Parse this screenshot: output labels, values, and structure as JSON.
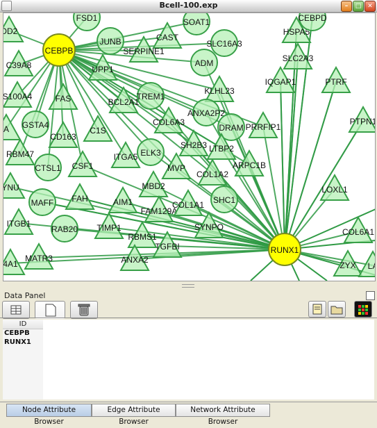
{
  "window": {
    "title": "Bcell-100.exp"
  },
  "network": {
    "hubs": [
      "CEBPB",
      "RUNX1"
    ],
    "nodes": [
      "FSD1",
      "OD2",
      "C39A8",
      "S100A4",
      "A",
      "RBM47",
      "YNU",
      "ITGB1",
      "4A1",
      "MATR3",
      "RAB20",
      "MAFF",
      "CTSL1",
      "FAH",
      "CSF1",
      "CD163",
      "GSTA4",
      "FAS",
      "C1S",
      "UPP1",
      "JUNB",
      "CAST",
      "SERPINE1",
      "SOAT1",
      "SLC16A3",
      "ADM",
      "HSPA5",
      "CEBPD",
      "SLC2A3",
      "IQGAP1",
      "PTRF",
      "KLHL23",
      "TREM1",
      "BCL2A1",
      "ANXA2P2",
      "COL6A3",
      "DRAM",
      "PRRFIP1",
      "PTPN1",
      "SH2B3",
      "LTBP2",
      "ARPC1B",
      "ELK3",
      "ITGA5",
      "MVP",
      "COL1A2",
      "MBD2",
      "AIM1",
      "FAM129A",
      "COL1A1",
      "SHC1",
      "TIMP1",
      "RBMS1",
      "SYNPO",
      "TGFBI",
      "ANXA2",
      "LOXL1",
      "COL6A1",
      "ZYX",
      "LA"
    ]
  },
  "data_panel": {
    "label": "Data Panel",
    "column_header": "ID",
    "rows": [
      "CEBPB",
      "RUNX1"
    ]
  },
  "bottom_tabs": [
    "Node Attribute Browser",
    "Edge Attribute Browser",
    "Network Attribute Browser"
  ],
  "colors": {
    "node_fill": "#b6f0b6",
    "node_stroke": "#38a048",
    "edge": "#2f9a44",
    "hub_fill": "#ffff00",
    "hub_stroke": "#7a8a1e"
  }
}
